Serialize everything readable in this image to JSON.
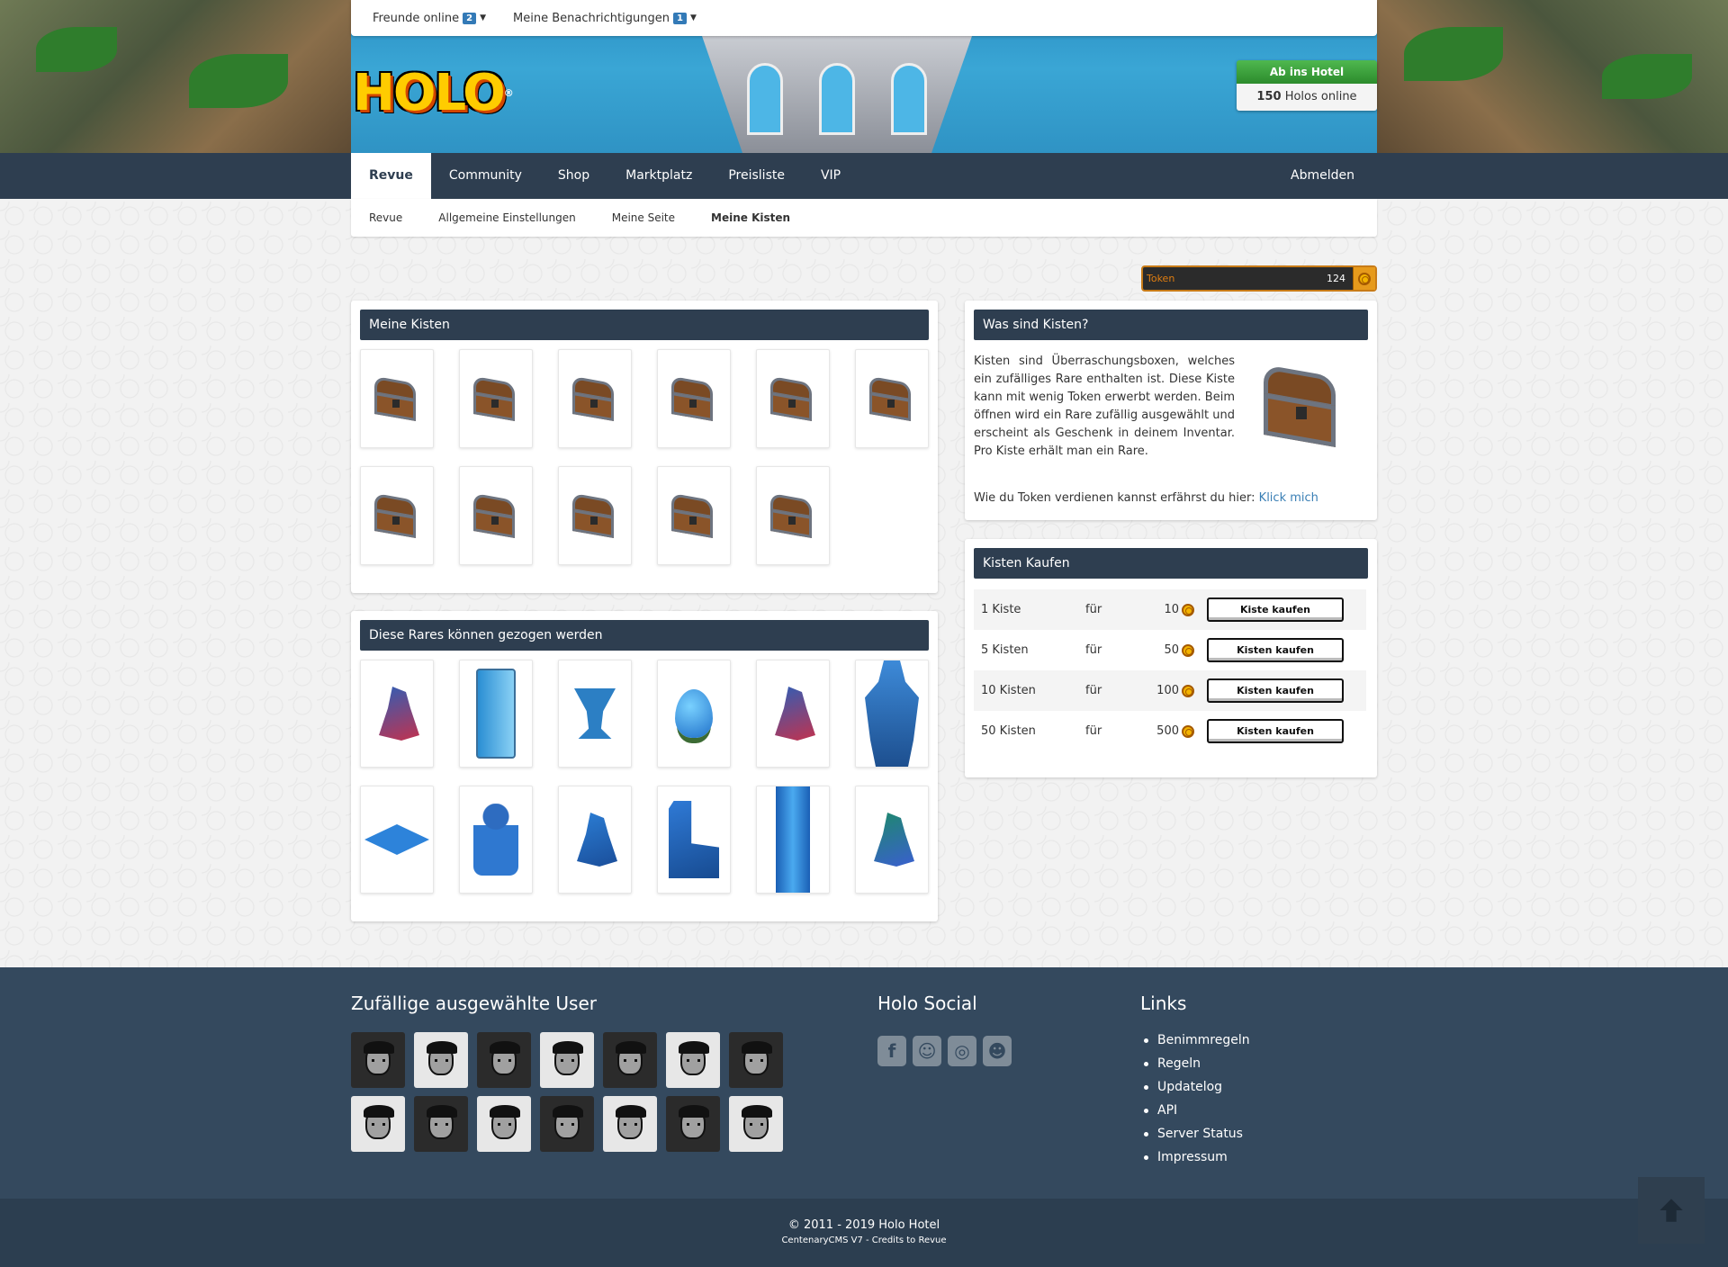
{
  "topbar": {
    "friends_label": "Freunde online",
    "friends_count": "2",
    "notifications_label": "Meine Benachrichtigungen",
    "notifications_count": "1"
  },
  "logo_text": "HOLO",
  "hotel": {
    "enter_label": "Ab ins Hotel",
    "online_count": "150",
    "online_label": "Holos online"
  },
  "nav": {
    "items": [
      "Revue",
      "Community",
      "Shop",
      "Marktplatz",
      "Preisliste",
      "VIP"
    ],
    "active": "Revue",
    "logout": "Abmelden"
  },
  "subnav": {
    "items": [
      "Revue",
      "Allgemeine Einstellungen",
      "Meine Seite",
      "Meine Kisten"
    ],
    "active": "Meine Kisten"
  },
  "token": {
    "label": "Token",
    "value": "124"
  },
  "my_chests": {
    "title": "Meine Kisten",
    "count": 11
  },
  "rares": {
    "title": "Diese Rares können gezogen werden",
    "items": [
      "dragon-red-icon",
      "ice-machine-icon",
      "ice-cup-icon",
      "blue-egg-icon",
      "dragon-red-icon",
      "blue-armor-statue-icon",
      "blue-pillow-icon",
      "blue-figure-icon",
      "blue-dragon-icon",
      "blue-throne-icon",
      "blue-pillar-icon",
      "green-dragon-icon"
    ]
  },
  "about": {
    "title": "Was sind Kisten?",
    "text": "Kisten sind Überraschungsboxen, welches ein zufälliges Rare enthalten ist. Diese Kiste kann mit wenig Token erwerbt werden. Beim öffnen wird ein Rare zufällig ausgewählt und erscheint als Geschenk in deinem Inventar. Pro Kiste erhält man ein Rare.",
    "earn_text": "Wie du Token verdienen kannst erfährst du hier:",
    "earn_link": "Klick mich"
  },
  "buy": {
    "title": "Kisten Kaufen",
    "rows": [
      {
        "qty": "1 Kiste",
        "for": "für",
        "price": "10",
        "button": "Kiste kaufen"
      },
      {
        "qty": "5 Kisten",
        "for": "für",
        "price": "50",
        "button": "Kisten kaufen"
      },
      {
        "qty": "10 Kisten",
        "for": "für",
        "price": "100",
        "button": "Kisten kaufen"
      },
      {
        "qty": "50 Kisten",
        "for": "für",
        "price": "500",
        "button": "Kisten kaufen"
      }
    ]
  },
  "footer": {
    "users_title": "Zufällige ausgewählte User",
    "social_title": "Holo Social",
    "links_title": "Links",
    "links": [
      "Benimmregeln",
      "Regeln",
      "Updatelog",
      "API",
      "Server Status",
      "Impressum"
    ],
    "social_icons": [
      "facebook-icon",
      "snapchat-icon",
      "instagram-icon",
      "discord-icon"
    ]
  },
  "copyright": {
    "line1": "© 2011 - 2019 Holo Hotel",
    "line2": "CentenaryCMS V7 - Credits to Revue"
  },
  "colors": {
    "nav_bg": "#2e3e50",
    "footer_bg": "#34495e",
    "hotel_green": "#2c8b2c",
    "token_orange": "#e69a1c",
    "link_blue": "#3a7fb5"
  }
}
